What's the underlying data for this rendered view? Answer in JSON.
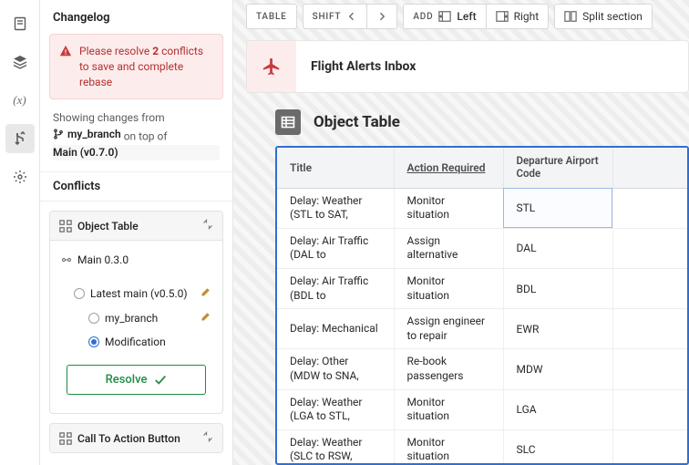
{
  "rail": {
    "items": [
      "document",
      "layers",
      "variables",
      "merge",
      "settings"
    ]
  },
  "panel": {
    "title": "Changelog",
    "alert": {
      "prefix": "Please resolve ",
      "count": "2",
      "suffix": " conflicts to save and complete rebase"
    },
    "info": {
      "showing": "Showing changes from",
      "branch": "my_branch",
      "ontopof": " on top of ",
      "main": "Main (v0.7.0)"
    },
    "conflicts_hdr": "Conflicts",
    "conflict1": {
      "name": "Object Table",
      "tree": {
        "root": "Main 0.3.0",
        "latest": "Latest main (v0.5.0)",
        "branch": "my_branch",
        "mod": "Modification"
      },
      "resolve": "Resolve"
    },
    "conflict2": {
      "name": "Call To Action Button"
    }
  },
  "toolbar": {
    "table": "TABLE",
    "shift": "SHIFT",
    "add": "ADD",
    "left": "Left",
    "right": "Right",
    "split": "Split section"
  },
  "header": {
    "title": "Flight Alerts Inbox"
  },
  "object_table_label": "Object Table",
  "table": {
    "cols": {
      "title": "Title",
      "action": "Action Required",
      "dep": "Departure Airport Code"
    },
    "rows": [
      {
        "title": "Delay: Weather (STL to SAT,",
        "action": "Monitor situation",
        "dep": "STL"
      },
      {
        "title": "Delay: Air Traffic (DAL to",
        "action": "Assign alternative",
        "dep": "DAL"
      },
      {
        "title": "Delay: Air Traffic (BDL to",
        "action": "Monitor situation",
        "dep": "BDL"
      },
      {
        "title": "Delay: Mechanical",
        "action": "Assign engineer to repair",
        "dep": "EWR"
      },
      {
        "title": "Delay: Other (MDW to SNA,",
        "action": "Re-book passengers",
        "dep": "MDW"
      },
      {
        "title": "Delay: Weather (LGA to STL,",
        "action": "Monitor situation",
        "dep": "LGA"
      },
      {
        "title": "Delay: Weather (SLC to RSW,",
        "action": "Monitor situation",
        "dep": "SLC"
      }
    ]
  }
}
